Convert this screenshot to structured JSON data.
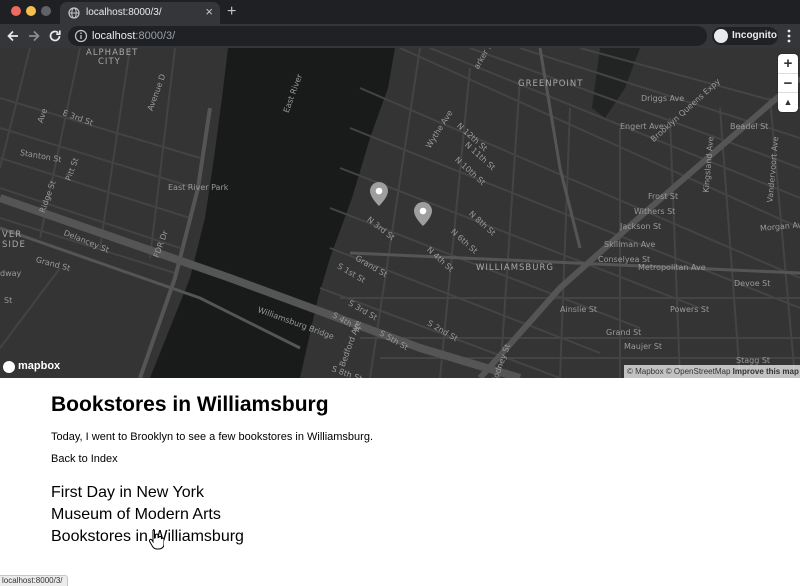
{
  "browser": {
    "tab_title": "localhost:8000/3/",
    "url_host": "localhost",
    "url_path": ":8000/3/",
    "incognito_label": "Incognito"
  },
  "map": {
    "labels": {
      "alphabet_city_1": "ALPHABET",
      "alphabet_city_2": "CITY",
      "greenpoint": "GREENPOINT",
      "williamsburg": "WILLIAMSBURG",
      "east_river_park": "East River Park",
      "east_river": "East River",
      "williamsburg_bridge": "Williamsburg Bridge",
      "wythe_ave": "Wythe Ave",
      "n12": "N 12th St",
      "n11": "N 11th St",
      "n10": "N 10th St",
      "n8": "N 8th St",
      "n6": "N 6th St",
      "n4": "N 4th St",
      "n3": "N 3rd St",
      "grand_st_w": "Grand St",
      "s1": "S 1st St",
      "s3": "S 3rd St",
      "s4": "S 4th St",
      "s2": "S 2nd St",
      "s5": "S 5th St",
      "s8": "S 8th St",
      "bedford": "Bedford Ave",
      "stanton": "Stanton St",
      "e3": "E 3rd St",
      "ave_d": "Avenue D",
      "delancey": "Delancey St",
      "grand_les": "Grand St",
      "pitt": "Pitt St",
      "ridge": "Ridge St",
      "fdr": "FDR Dr",
      "ver_side_1": "VER",
      "ver_side_2": "SIDE",
      "dway": "dway",
      "st_edge": "St",
      "driggs": "Driggs Ave",
      "engert": "Engert Ave",
      "bqe": "Brooklyn Queens Expy",
      "frost": "Frost St",
      "withers": "Withers St",
      "jackson": "Jackson St",
      "skillman": "Skillman Ave",
      "conselyea": "Conselyea St",
      "metropolitan": "Metropolitan Ave",
      "devoe": "Devoe St",
      "ainslie": "Ainslie St",
      "powers": "Powers St",
      "grand_east": "Grand St",
      "maujer": "Maujer St",
      "stagg": "Stagg St",
      "kingsland": "Kingsland Ave",
      "vanderv": "Vandervoort Ave",
      "morgan": "Morgan Ave",
      "beadel": "Beadel St",
      "rodney": "Rodney St",
      "ave_a": "Ave",
      "parker": "arker St"
    },
    "zoom_in": "+",
    "zoom_out": "−",
    "compass": "▲",
    "logo": "mapbox",
    "attribution": "© Mapbox © OpenStreetMap",
    "improve": "Improve this map"
  },
  "page": {
    "title": "Bookstores in Williamsburg",
    "intro": "Today, I went to Brooklyn to see a few bookstores in Williamsburg.",
    "back_link": "Back to Index",
    "posts": [
      "First Day in New York",
      "Museum of Modern Arts",
      "Bookstores in Williamsburg"
    ]
  },
  "status_bar": "localhost:8000/3/",
  "colors": {
    "map_land": "#343434",
    "map_water": "#191a1a",
    "map_road": "#4a4a4a",
    "marker": "#9e9e9e"
  }
}
